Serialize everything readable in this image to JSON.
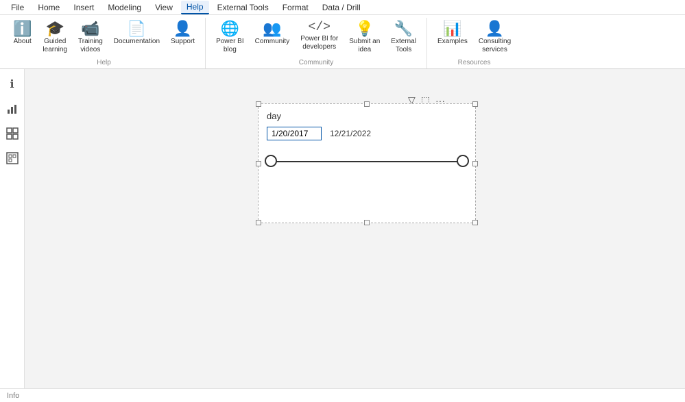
{
  "menubar": {
    "items": [
      "File",
      "Home",
      "Insert",
      "Modeling",
      "View",
      "Help",
      "External Tools",
      "Format",
      "Data / Drill"
    ],
    "active": "Help"
  },
  "ribbon": {
    "groups": [
      {
        "label": "Help",
        "buttons": [
          {
            "id": "about",
            "label": "About",
            "icon": "ℹ"
          },
          {
            "id": "guided-learning",
            "label": "Guided\nlearning",
            "icon": "🎓"
          },
          {
            "id": "training-videos",
            "label": "Training\nvideos",
            "icon": "🎥"
          },
          {
            "id": "documentation",
            "label": "Documentation",
            "icon": "📄"
          },
          {
            "id": "support",
            "label": "Support",
            "icon": "👤"
          }
        ]
      },
      {
        "label": "Community",
        "buttons": [
          {
            "id": "power-bi-blog",
            "label": "Power BI\nblog",
            "icon": "🌐"
          },
          {
            "id": "community",
            "label": "Community",
            "icon": "👥"
          },
          {
            "id": "power-bi-developers",
            "label": "Power BI for\ndevelopers",
            "icon": "</>"
          },
          {
            "id": "submit-idea",
            "label": "Submit an\nidea",
            "icon": "💡"
          },
          {
            "id": "external-tools",
            "label": "External\nTools",
            "icon": "🔧"
          }
        ]
      },
      {
        "label": "Resources",
        "buttons": [
          {
            "id": "examples",
            "label": "Examples",
            "icon": "📊"
          },
          {
            "id": "consulting-services",
            "label": "Consulting\nservices",
            "icon": "👤"
          }
        ]
      }
    ]
  },
  "sidebar": {
    "icons": [
      {
        "id": "info",
        "symbol": "ℹ",
        "label": "Info"
      },
      {
        "id": "chart",
        "symbol": "📊",
        "label": "Chart"
      },
      {
        "id": "table",
        "symbol": "⊞",
        "label": "Table"
      },
      {
        "id": "filter",
        "symbol": "🔲",
        "label": "Filter"
      }
    ]
  },
  "slicer": {
    "title": "day",
    "start_date": "1/20/2017",
    "end_date": "12/21/2022",
    "toolbar": {
      "filter_icon": "▽",
      "expand_icon": "⬚",
      "more_icon": "···"
    }
  },
  "statusbar": {
    "page_label": "Info"
  }
}
